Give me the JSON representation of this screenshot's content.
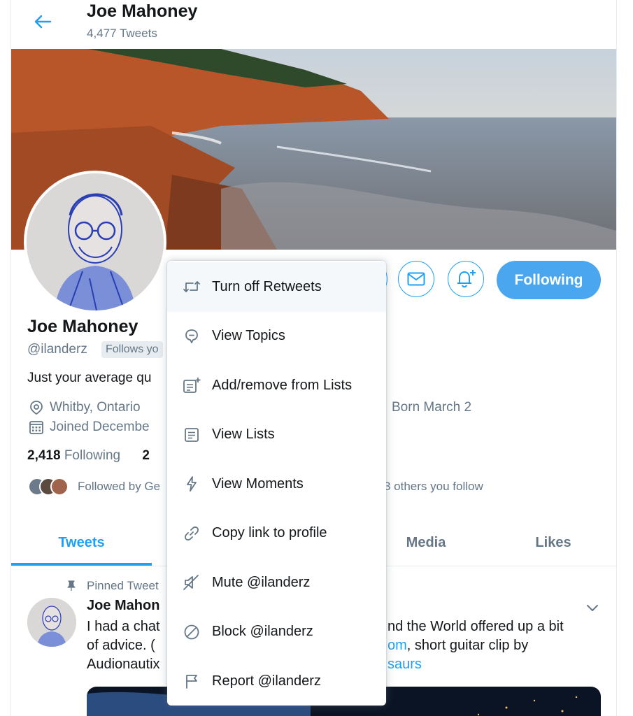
{
  "header": {
    "name": "Joe Mahoney",
    "tweet_count": "4,477 Tweets"
  },
  "profile": {
    "name": "Joe Mahoney",
    "handle": "@ilanderz",
    "follows_badge": "Follows yo",
    "bio": "Just your average qu",
    "location": "Whitby, Ontario",
    "joined": "Joined Decembe",
    "born": "Born March 2",
    "following_count": "2,418",
    "following_label": "Following",
    "followers_count": "2",
    "followed_by_prefix": "Followed by Ge",
    "followed_by_suffix": "3 others you follow",
    "following_button": "Following"
  },
  "tabs": [
    {
      "label": "Tweets",
      "active": true
    },
    {
      "label": "Media",
      "active": false
    },
    {
      "label": "Likes",
      "active": false
    }
  ],
  "pinned_tweet": {
    "pinned_label": "Pinned Tweet",
    "author": "Joe Mahon",
    "line1_a": "I had a chat",
    "line1_b": "nd the World offered up a bit",
    "line2_a": "of advice. (",
    "line2_link": "om",
    "line2_b": ", short guitar clip by",
    "line3_a": "Audionautix",
    "line3_link": "saurs"
  },
  "menu": {
    "items": [
      {
        "label": "Turn off Retweets",
        "icon": "retweet-icon"
      },
      {
        "label": "View Topics",
        "icon": "topics-icon"
      },
      {
        "label": "Add/remove from Lists",
        "icon": "add-list-icon"
      },
      {
        "label": "View Lists",
        "icon": "lists-icon"
      },
      {
        "label": "View Moments",
        "icon": "moments-icon"
      },
      {
        "label": "Copy link to profile",
        "icon": "link-icon"
      },
      {
        "label": "Mute @ilanderz",
        "icon": "mute-icon"
      },
      {
        "label": "Block @ilanderz",
        "icon": "block-icon"
      },
      {
        "label": "Report @ilanderz",
        "icon": "report-icon"
      }
    ]
  },
  "colors": {
    "accent": "#1da1f2",
    "following_button": "#4aa6ee",
    "secondary_text": "#657786"
  }
}
